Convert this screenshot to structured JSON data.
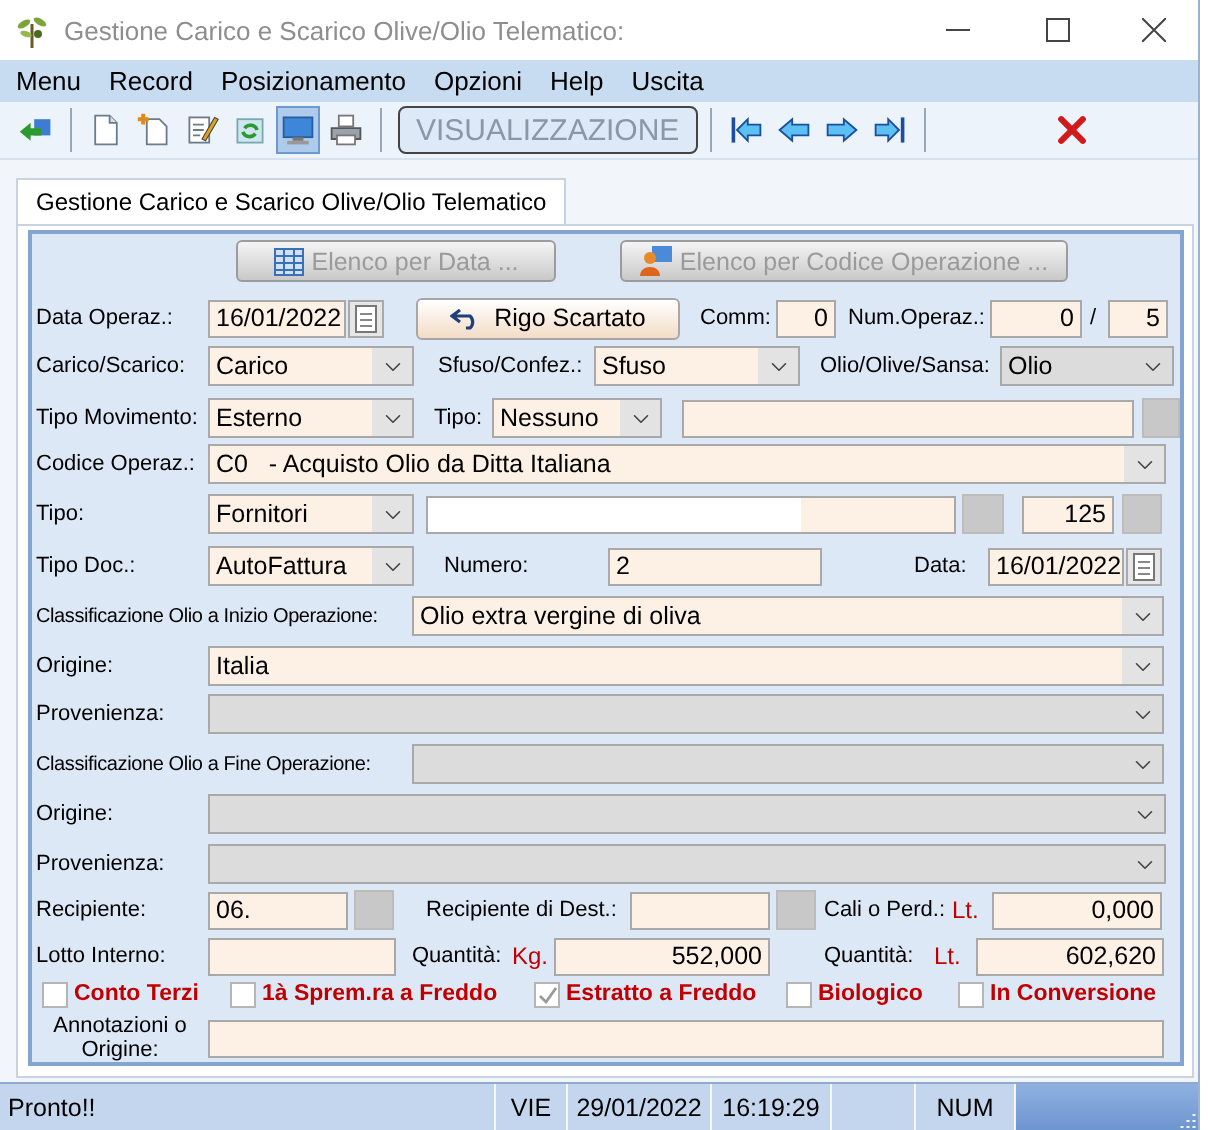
{
  "window": {
    "title": "Gestione Carico e Scarico Olive/Olio Telematico:"
  },
  "menu": [
    "Menu",
    "Record",
    "Posizionamento",
    "Opzioni",
    "Help",
    "Uscita"
  ],
  "toolbar": [
    {
      "kind": "exit",
      "selected": false
    },
    {
      "kind": "separator"
    },
    {
      "kind": "new",
      "selected": false
    },
    {
      "kind": "copy",
      "selected": false
    },
    {
      "kind": "edit",
      "selected": false
    },
    {
      "kind": "refresh",
      "selected": false
    },
    {
      "kind": "view",
      "selected": true
    },
    {
      "kind": "print",
      "selected": false
    },
    {
      "kind": "separator"
    },
    {
      "kind": "mode",
      "label": "VISUALIZZAZIONE"
    },
    {
      "kind": "separator"
    },
    {
      "kind": "first",
      "selected": false
    },
    {
      "kind": "previous",
      "selected": false
    },
    {
      "kind": "next",
      "selected": false
    },
    {
      "kind": "last",
      "selected": false
    },
    {
      "kind": "separator"
    },
    {
      "kind": "delete",
      "selected": false
    }
  ],
  "tabs": [
    {
      "label": "Gestione Carico e Scarico Olive/Olio Telematico",
      "selected": true
    }
  ],
  "form": {
    "list_buttons": [
      {
        "kind": "date_list",
        "label": "Elenco per Data ...",
        "disabled": true
      },
      {
        "kind": "code_list",
        "label": "Elenco per Codice Operazione ...",
        "disabled": true
      }
    ],
    "lines": [
      {
        "controls": [
          {
            "kind": "label",
            "text": "Data Operaz.:"
          },
          {
            "kind": "date",
            "value": "16/01/2022"
          },
          {
            "kind": "button",
            "label": "Rigo Scartato"
          },
          {
            "kind": "label",
            "text": "Comm:"
          },
          {
            "kind": "number",
            "value": "0"
          },
          {
            "kind": "label",
            "text": "Num.Operaz.:"
          },
          {
            "kind": "number",
            "value": "0"
          },
          {
            "kind": "label",
            "text": "/"
          },
          {
            "kind": "number",
            "value": "5"
          }
        ]
      },
      {
        "controls": [
          {
            "kind": "label",
            "text": "Carico/Scarico:"
          },
          {
            "kind": "combo",
            "value": "Carico",
            "disabled": false
          },
          {
            "kind": "label",
            "text": "Sfuso/Confez.:"
          },
          {
            "kind": "combo",
            "value": "Sfuso",
            "disabled": false
          },
          {
            "kind": "label",
            "text": "Olio/Olive/Sansa:"
          },
          {
            "kind": "combo",
            "value": "Olio",
            "disabled": true
          }
        ]
      },
      {
        "controls": [
          {
            "kind": "label",
            "text": "Tipo Movimento:"
          },
          {
            "kind": "combo",
            "value": "Esterno",
            "disabled": false
          },
          {
            "kind": "label",
            "text": "Tipo:"
          },
          {
            "kind": "combo",
            "value": "Nessuno",
            "disabled": false
          },
          {
            "kind": "field"
          },
          {
            "kind": "square"
          }
        ]
      },
      {
        "controls": [
          {
            "kind": "label",
            "text": "Codice Operaz.:"
          },
          {
            "kind": "combo",
            "value": "C0   - Acquisto Olio da Ditta Italiana",
            "disabled": false
          }
        ]
      },
      {
        "controls": [
          {
            "kind": "label",
            "text": "Tipo:"
          },
          {
            "kind": "combo",
            "value": "Fornitori",
            "disabled": false
          },
          {
            "kind": "masked"
          },
          {
            "kind": "square"
          },
          {
            "kind": "number",
            "value": "125"
          },
          {
            "kind": "square"
          }
        ]
      },
      {
        "controls": [
          {
            "kind": "label",
            "text": "Tipo Doc.:"
          },
          {
            "kind": "combo",
            "value": "AutoFattura",
            "disabled": false
          },
          {
            "kind": "label",
            "text": "Numero:"
          },
          {
            "kind": "field",
            "value": "2"
          },
          {
            "kind": "label",
            "text": "Data:"
          },
          {
            "kind": "date",
            "value": "16/01/2022"
          }
        ]
      },
      {
        "controls": [
          {
            "kind": "label",
            "text": "Classificazione Olio a Inizio Operazione:"
          },
          {
            "kind": "combo",
            "value": "Olio extra vergine di oliva",
            "disabled": false
          }
        ]
      },
      {
        "controls": [
          {
            "kind": "label",
            "text": "Origine:"
          },
          {
            "kind": "combo",
            "value": "Italia",
            "disabled": false
          }
        ]
      },
      {
        "controls": [
          {
            "kind": "label",
            "text": "Provenienza:"
          },
          {
            "kind": "combo",
            "disabled": true
          }
        ]
      },
      {
        "controls": [
          {
            "kind": "label",
            "text": "Classificazione Olio a Fine Operazione:"
          },
          {
            "kind": "combo",
            "disabled": true
          }
        ]
      },
      {
        "controls": [
          {
            "kind": "label",
            "text": "Origine:"
          },
          {
            "kind": "combo",
            "disabled": true
          }
        ]
      },
      {
        "controls": [
          {
            "kind": "label",
            "text": "Provenienza:"
          },
          {
            "kind": "combo",
            "disabled": true
          }
        ]
      },
      {
        "controls": [
          {
            "kind": "label",
            "text": "Recipiente:"
          },
          {
            "kind": "field",
            "value": "06."
          },
          {
            "kind": "square"
          },
          {
            "kind": "label",
            "text": "Recipiente di Dest.:"
          },
          {
            "kind": "field"
          },
          {
            "kind": "square"
          },
          {
            "kind": "label",
            "text": "Cali o Perd.:"
          },
          {
            "kind": "unit",
            "text": "Lt."
          },
          {
            "kind": "number",
            "value": "0,000"
          }
        ]
      },
      {
        "controls": [
          {
            "kind": "label",
            "text": "Lotto Interno:"
          },
          {
            "kind": "field"
          },
          {
            "kind": "label",
            "text": "Quantità:"
          },
          {
            "kind": "unit",
            "text": "Kg."
          },
          {
            "kind": "number",
            "value": "552,000"
          },
          {
            "kind": "label",
            "text": "Quantità:"
          },
          {
            "kind": "unit",
            "text": "Lt."
          },
          {
            "kind": "number",
            "value": "602,620"
          }
        ]
      }
    ],
    "options": [
      {
        "label": "Conto Terzi",
        "checked": false
      },
      {
        "label": "1à Sprem.ra a Freddo",
        "checked": false
      },
      {
        "label": "Estratto a Freddo",
        "checked": true
      },
      {
        "label": "Biologico",
        "checked": false
      },
      {
        "label": "In Conversione",
        "checked": false
      }
    ],
    "notes": {
      "label": "Annotazioni o Origine:"
    }
  },
  "status_bar": {
    "message": "Pronto!!",
    "day": "VIE",
    "date": "29/01/2022",
    "time": "16:19:29",
    "keys": "NUM"
  }
}
